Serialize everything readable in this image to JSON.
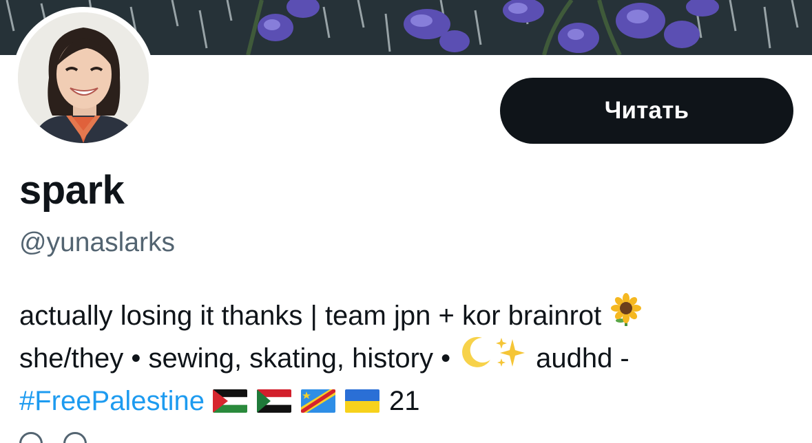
{
  "profile": {
    "display_name": "spark",
    "handle": "@yunaslarks",
    "follow_label": "Читать"
  },
  "bio": {
    "line1_text": "actually losing it thanks | team jpn + kor brainrot",
    "line1_emoji": "sunflower-emoji",
    "line2_text": "she/they • sewing, skating, history •",
    "line2_emojis": [
      "crescent-moon-emoji",
      "sparkles-emoji"
    ],
    "line2_tail": "audhd -",
    "hashtag": "#FreePalestine",
    "flags": [
      "palestine-flag",
      "sudan-flag",
      "dr-congo-flag",
      "ukraine-flag"
    ],
    "line3_tail": "21"
  },
  "colors": {
    "text": "#0f1419",
    "secondary": "#536471",
    "link": "#1d9bf0",
    "button_bg": "#0f1419",
    "button_text": "#ffffff"
  }
}
